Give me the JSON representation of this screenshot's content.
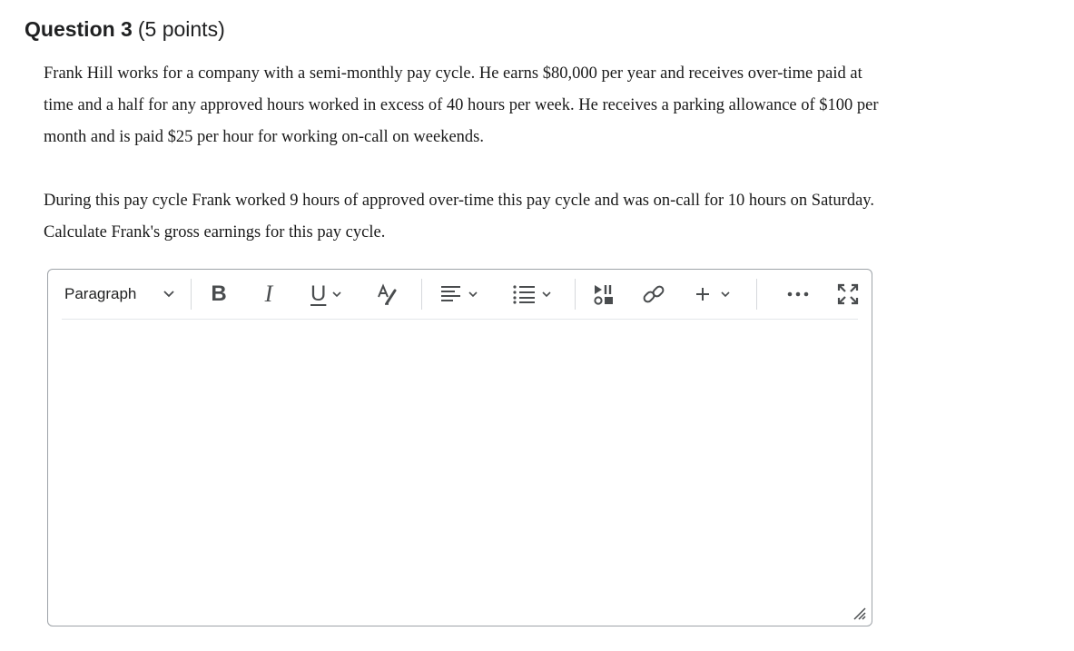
{
  "question": {
    "title": "Question 3",
    "points": "(5 points)",
    "paragraphs": [
      "Frank Hill works for a company with a semi-monthly pay cycle. He earns $80,000 per year and receives over-time paid at time and a half for any approved hours worked in excess of 40 hours per week. He receives a parking allowance of $100 per month and is paid $25 per hour for working on-call on weekends.",
      "During this pay cycle Frank worked 9 hours of approved over-time this pay cycle and was on-call for 10 hours on Saturday. Calculate Frank's gross earnings for this pay cycle."
    ]
  },
  "editor": {
    "toolbar": {
      "paragraph_style": "Paragraph",
      "bold": "B",
      "italic": "I",
      "underline": "U",
      "icons": {
        "paragraph_dropdown": "chevron-down-icon",
        "format": "text-format-icon",
        "align": "align-left-icon",
        "list": "bulleted-list-icon",
        "media": "insert-media-icon",
        "link": "link-icon",
        "insert": "plus-icon",
        "more": "more-options-icon",
        "fullscreen": "fullscreen-icon"
      }
    },
    "content": "",
    "colors": {
      "border": "#9ea3a8",
      "icon": "#494c4e",
      "text": "#202122"
    }
  }
}
